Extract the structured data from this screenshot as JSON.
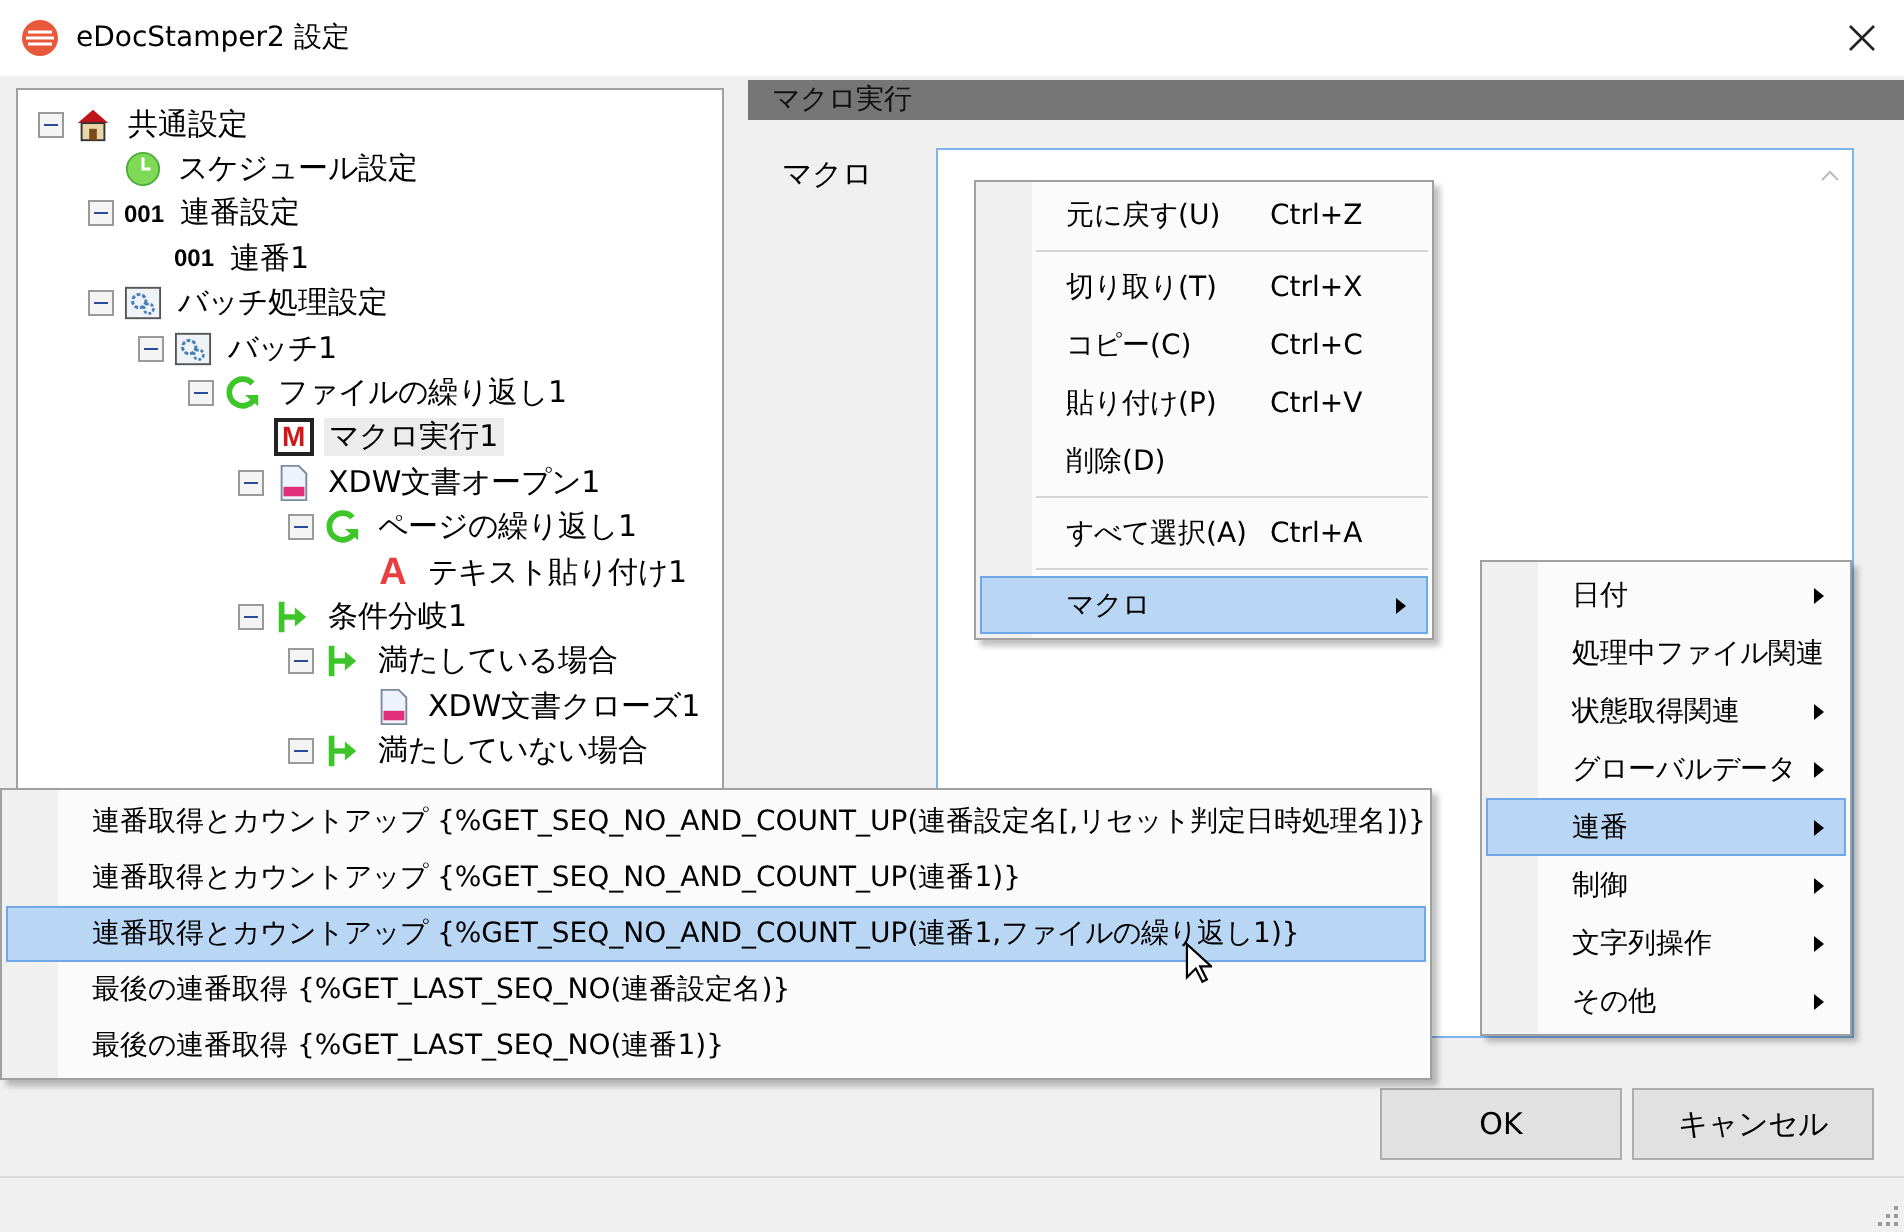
{
  "window": {
    "title": "eDocStamper2 設定"
  },
  "tree": [
    {
      "label": "共通設定",
      "kind": "house",
      "selected": false,
      "expanded": true,
      "children": [
        {
          "label": "スケジュール設定",
          "kind": "clock",
          "selected": false
        },
        {
          "label": "連番設定",
          "kind": "counter",
          "icon_text": "001",
          "selected": false,
          "expanded": true,
          "children": [
            {
              "label": "連番1",
              "kind": "counter",
              "icon_text": "001",
              "selected": false
            }
          ]
        },
        {
          "label": "バッチ処理設定",
          "kind": "gears",
          "selected": false,
          "expanded": true,
          "children": [
            {
              "label": "バッチ1",
              "kind": "gears",
              "selected": false,
              "expanded": true,
              "children": [
                {
                  "label": "ファイルの繰り返し1",
                  "kind": "loop",
                  "selected": false,
                  "expanded": true,
                  "children": [
                    {
                      "label": "マクロ実行1",
                      "kind": "macro",
                      "icon_text": "M",
                      "selected": true
                    },
                    {
                      "label": "XDW文書オープン1",
                      "kind": "doc",
                      "selected": false,
                      "expanded": true,
                      "children": [
                        {
                          "label": "ページの繰り返し1",
                          "kind": "loop",
                          "selected": false,
                          "expanded": true,
                          "children": [
                            {
                              "label": "テキスト貼り付け1",
                              "kind": "letter",
                              "icon_text": "A",
                              "selected": false
                            }
                          ]
                        }
                      ]
                    },
                    {
                      "label": "条件分岐1",
                      "kind": "branch",
                      "selected": false,
                      "expanded": true,
                      "children": [
                        {
                          "label": "満たしている場合",
                          "kind": "branch",
                          "selected": false,
                          "expanded": true,
                          "children": [
                            {
                              "label": "XDW文書クローズ1",
                              "kind": "doc",
                              "selected": false
                            }
                          ]
                        },
                        {
                          "label": "満たしていない場合",
                          "kind": "branch",
                          "selected": false,
                          "expanded": true
                        }
                      ]
                    }
                  ]
                }
              ]
            }
          ]
        }
      ]
    }
  ],
  "panel": {
    "title": "マクロ実行",
    "field_label": "マクロ"
  },
  "context_menu": [
    {
      "kind": "item",
      "label": "元に戻す(U)",
      "shortcut": "Ctrl+Z",
      "selected": false
    },
    {
      "kind": "separator"
    },
    {
      "kind": "item",
      "label": "切り取り(T)",
      "shortcut": "Ctrl+X",
      "selected": false
    },
    {
      "kind": "item",
      "label": "コピー(C)",
      "shortcut": "Ctrl+C",
      "selected": false
    },
    {
      "kind": "item",
      "label": "貼り付け(P)",
      "shortcut": "Ctrl+V",
      "selected": false
    },
    {
      "kind": "item",
      "label": "削除(D)",
      "selected": false
    },
    {
      "kind": "separator"
    },
    {
      "kind": "item",
      "label": "すべて選択(A)",
      "shortcut": "Ctrl+A",
      "selected": false
    },
    {
      "kind": "separator"
    },
    {
      "kind": "submenu",
      "label": "マクロ",
      "selected": true
    }
  ],
  "macro_menu": [
    {
      "label": "日付",
      "selected": false
    },
    {
      "label": "処理中ファイル関連",
      "selected": false
    },
    {
      "label": "状態取得関連",
      "selected": false
    },
    {
      "label": "グローバルデータ",
      "selected": false
    },
    {
      "label": "連番",
      "selected": true
    },
    {
      "label": "制御",
      "selected": false
    },
    {
      "label": "文字列操作",
      "selected": false
    },
    {
      "label": "その他",
      "selected": false
    }
  ],
  "sequence_menu": [
    {
      "label": "連番取得とカウントアップ {%GET_SEQ_NO_AND_COUNT_UP(連番設定名[,リセット判定日時処理名])}",
      "selected": false
    },
    {
      "label": "連番取得とカウントアップ {%GET_SEQ_NO_AND_COUNT_UP(連番1)}",
      "selected": false
    },
    {
      "label": "連番取得とカウントアップ {%GET_SEQ_NO_AND_COUNT_UP(連番1,ファイルの繰り返し1)}",
      "selected": true
    },
    {
      "label": "最後の連番取得 {%GET_LAST_SEQ_NO(連番設定名)}",
      "selected": false
    },
    {
      "label": "最後の連番取得 {%GET_LAST_SEQ_NO(連番1)}",
      "selected": false
    }
  ],
  "buttons": [
    "OK",
    "キャンセル"
  ]
}
